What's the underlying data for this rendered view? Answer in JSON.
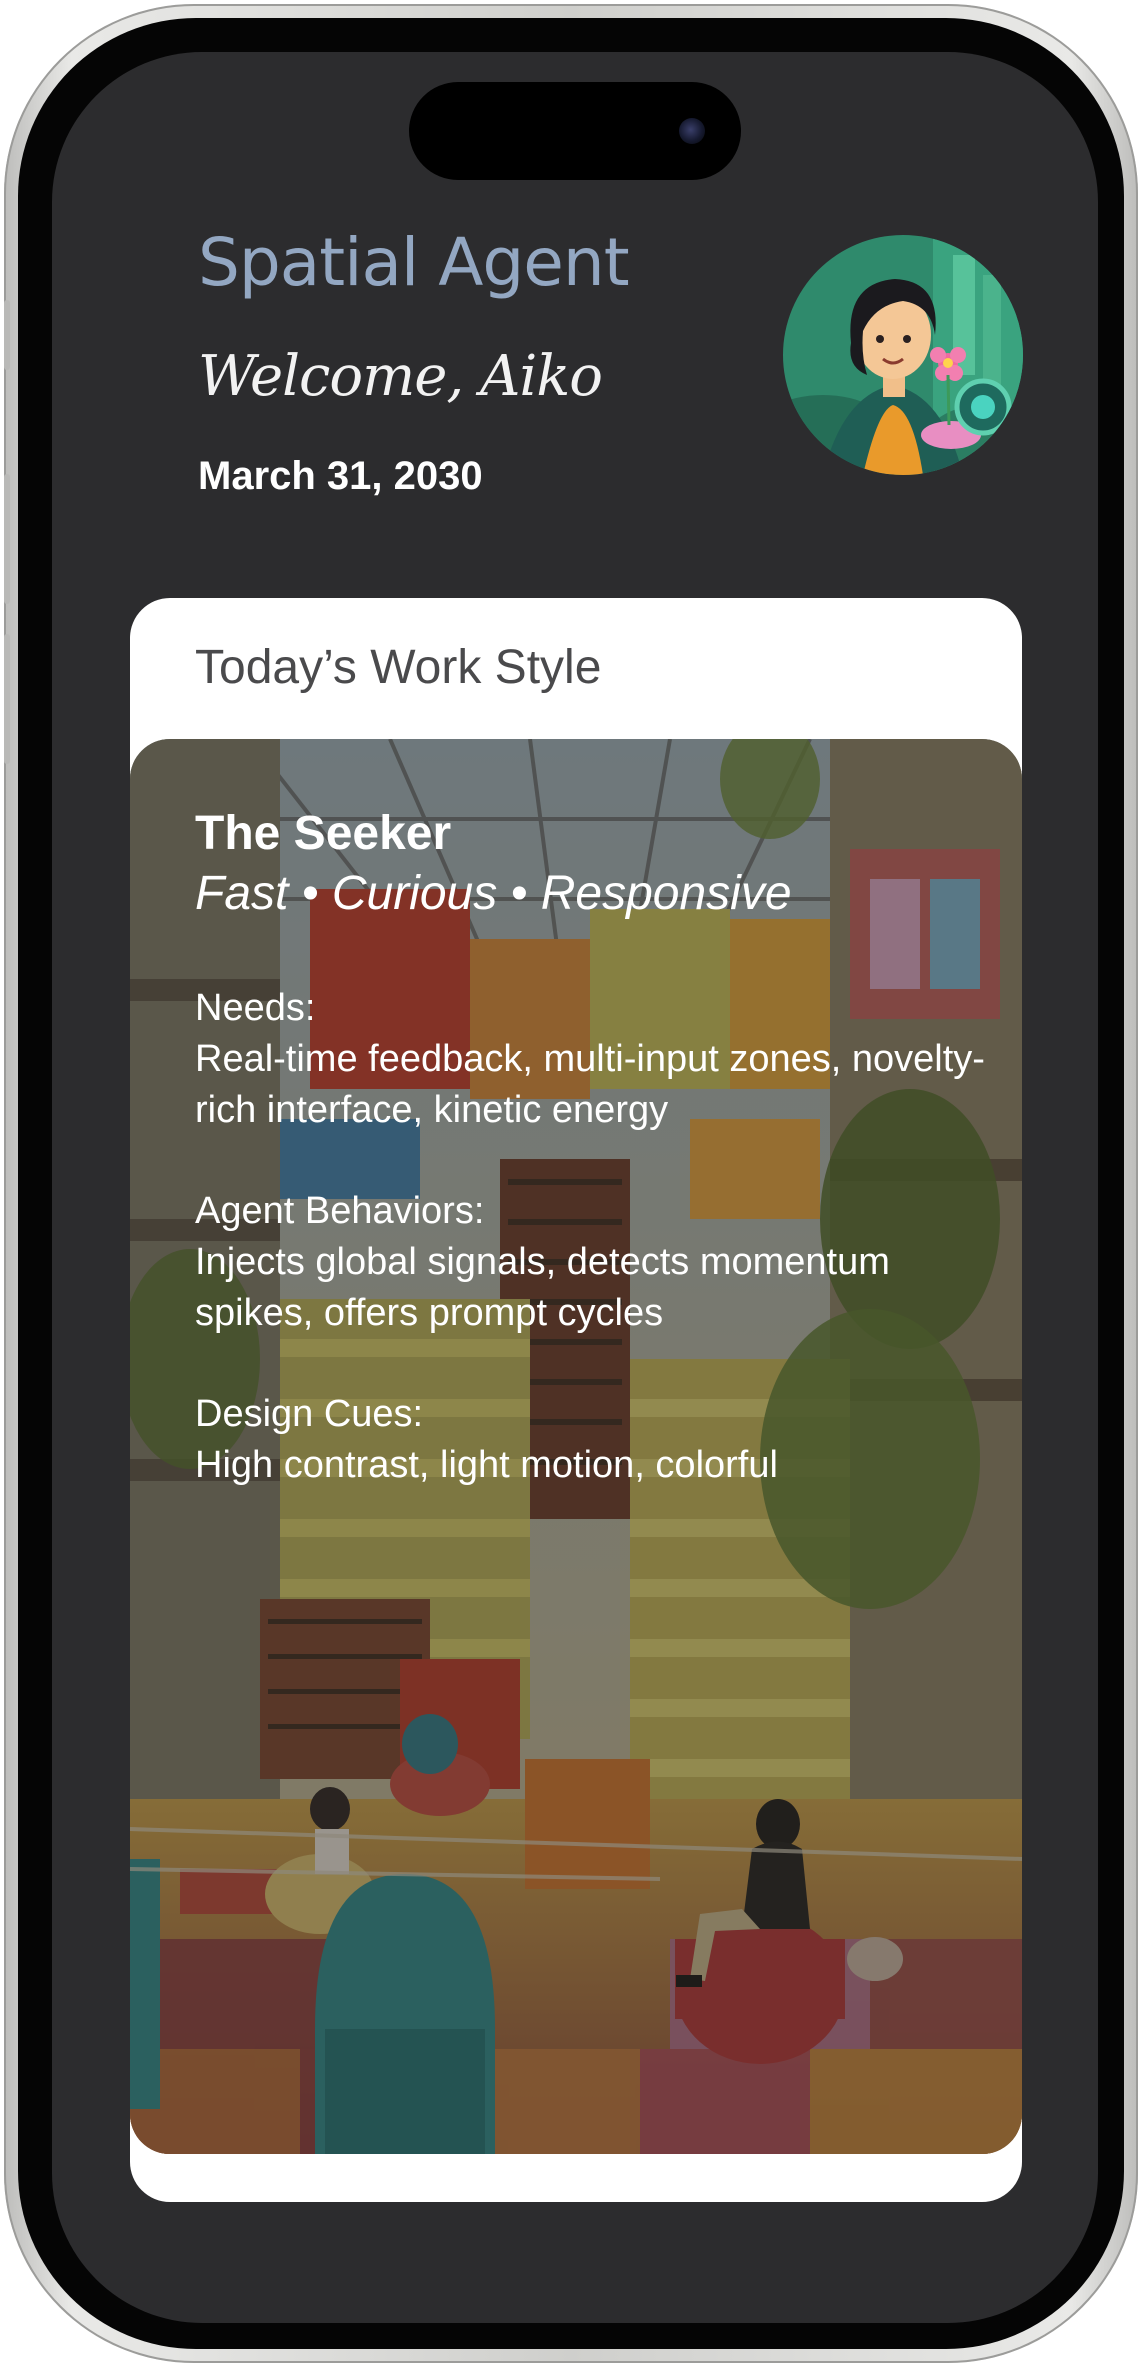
{
  "header": {
    "app_title": "Spatial Agent",
    "greeting": "Welcome, Aiko",
    "date": "March 31, 2030"
  },
  "avatar": {
    "icon": "illustrated-user-avatar"
  },
  "work_style_card": {
    "title": "Today’s Work Style",
    "background_image": "atrium-library-photo",
    "style_name": "The Seeker",
    "traits": "Fast • Curious • Responsive",
    "sections": [
      {
        "label": "Needs:",
        "text": "Real-time feedback, multi-input zones, novelty-rich interface, kinetic energy"
      },
      {
        "label": "Agent Behaviors:",
        "text": "Injects global signals, detects momentum spikes, offers prompt cycles"
      },
      {
        "label": "Design Cues:",
        "text": "High contrast, light motion, colorful"
      }
    ]
  },
  "colors": {
    "screen_background": "#2c2c2e",
    "title_accent": "#93a7c2",
    "card_background": "#ffffff"
  }
}
